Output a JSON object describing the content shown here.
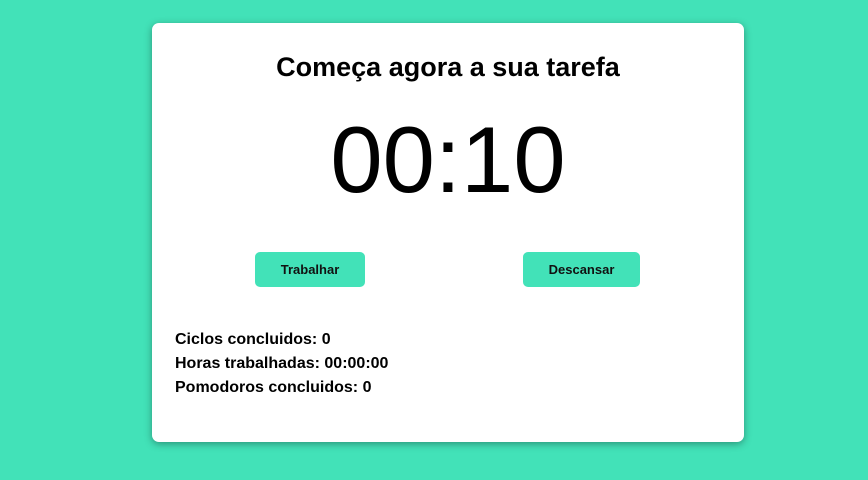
{
  "colors": {
    "background": "#42e2b8",
    "card": "#ffffff",
    "button": "#42e2b8"
  },
  "header": {
    "title": "Começa agora a sua tarefa"
  },
  "timer": {
    "display": "00:10"
  },
  "controls": {
    "work_label": "Trabalhar",
    "rest_label": "Descansar"
  },
  "stats": {
    "cycles_label": "Ciclos concluidos:",
    "cycles_value": "0",
    "hours_label": "Horas trabalhadas:",
    "hours_value": "00:00:00",
    "pomodoros_label": "Pomodoros concluidos:",
    "pomodoros_value": "0"
  }
}
